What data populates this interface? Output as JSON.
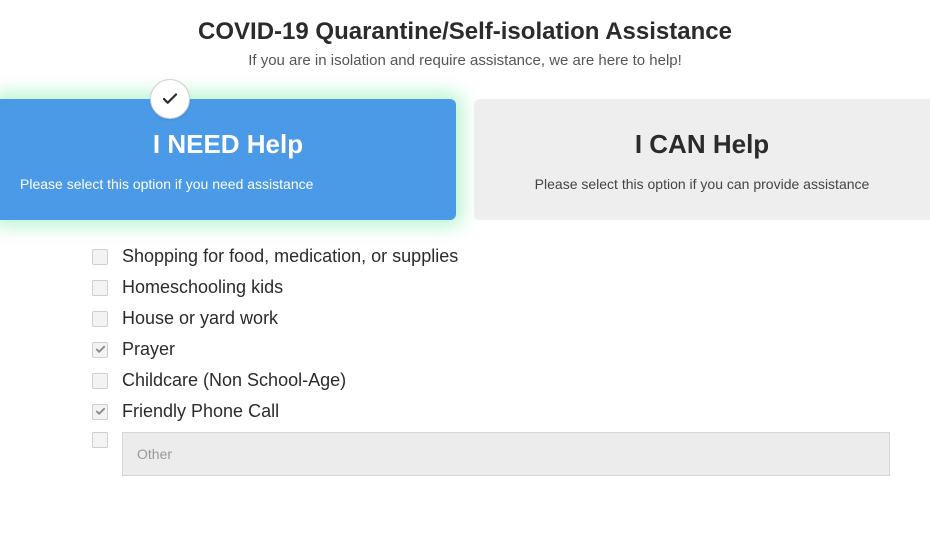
{
  "header": {
    "title": "COVID-19 Quarantine/Self-isolation Assistance",
    "subtitle": "If you are in isolation and require assistance, we are here to help!"
  },
  "tabs": {
    "need": {
      "title": "I NEED Help",
      "desc": "Please select this option if you need assistance",
      "selected": true
    },
    "can": {
      "title": "I CAN Help",
      "desc": "Please select this option if you can provide assistance",
      "selected": false
    }
  },
  "items": [
    {
      "label": "Shopping for food, medication, or supplies",
      "checked": false
    },
    {
      "label": "Homeschooling kids",
      "checked": false
    },
    {
      "label": "House or yard work",
      "checked": false
    },
    {
      "label": "Prayer",
      "checked": true
    },
    {
      "label": "Childcare (Non School-Age)",
      "checked": false
    },
    {
      "label": "Friendly Phone Call",
      "checked": true
    }
  ],
  "other": {
    "placeholder": "Other",
    "value": "",
    "checked": false
  }
}
